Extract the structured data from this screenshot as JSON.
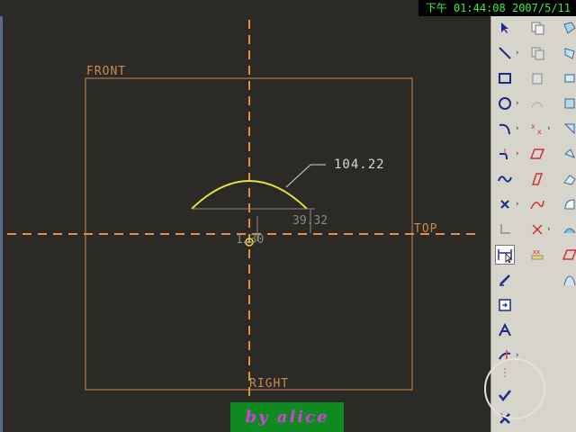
{
  "clock": {
    "text": "下午 01:44:08 2007/5/11"
  },
  "canvas": {
    "datum_planes": {
      "front": "FRONT",
      "top": "TOP",
      "right": "RIGHT"
    },
    "dimensions": {
      "arc_length": "104.22",
      "height": "39.32",
      "offset": "1.30"
    }
  },
  "credit": {
    "text": "by   alice"
  },
  "colors": {
    "background": "#2c2a26",
    "datum": "#c98a4e",
    "sketch": "#e8e13a",
    "dimension": "#8e8a83",
    "credit_bg": "#0e8a20",
    "credit_text": "#d53fd8",
    "clock_text": "#3df23d"
  },
  "toolbar": {
    "tools": [
      {
        "icon": "select-arrow-icon"
      },
      {
        "icon": "line-icon"
      },
      {
        "icon": "rectangle-icon"
      },
      {
        "icon": "circle-icon"
      },
      {
        "icon": "arc-icon"
      },
      {
        "icon": "fillet-icon"
      },
      {
        "icon": "spline-icon"
      },
      {
        "icon": "point-icon"
      },
      {
        "icon": "coordinate-system-icon"
      },
      {
        "icon": "dimension-icon"
      },
      {
        "icon": "modify-icon"
      },
      {
        "icon": "constraint-icon"
      },
      {
        "icon": "text-icon"
      },
      {
        "icon": "trim-icon"
      },
      {
        "icon": "mirror-icon"
      },
      {
        "icon": "accept-check-icon"
      },
      {
        "icon": "cancel-x-icon"
      }
    ]
  }
}
